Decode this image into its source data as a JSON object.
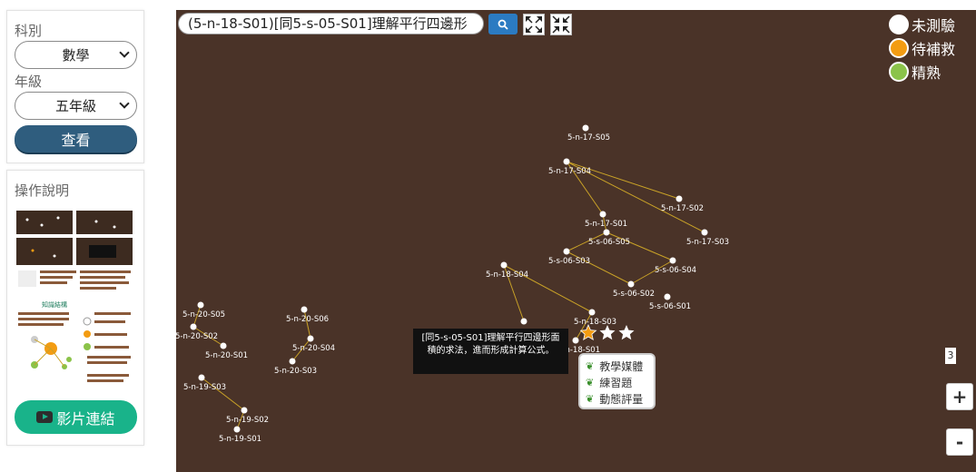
{
  "sidebar": {
    "subject_label": "科別",
    "subject_value": "數學",
    "grade_label": "年級",
    "grade_value": "五年級",
    "view_button": "查看",
    "guide_title": "操作說明",
    "video_button": "影片連結"
  },
  "toolbar": {
    "search_value": "(5-n-18-S01)[同5-s-05-S01]理解平行四邊形",
    "search_icon": "search-icon",
    "expand_icon": "expand-icon",
    "collapse_icon": "collapse-icon"
  },
  "legend": [
    {
      "label": "未測驗",
      "color": "#ffffff"
    },
    {
      "label": "待補救",
      "color": "#f39c12"
    },
    {
      "label": "精熟",
      "color": "#8bc34a"
    }
  ],
  "nodes": [
    {
      "id": "5-n-17-S05"
    },
    {
      "id": "5-n-17-S04"
    },
    {
      "id": "5-n-17-S02"
    },
    {
      "id": "5-n-17-S01"
    },
    {
      "id": "5-n-17-S03"
    },
    {
      "id": "5-s-06-S05"
    },
    {
      "id": "5-s-06-S03"
    },
    {
      "id": "5-s-06-S04"
    },
    {
      "id": "5-s-06-S02"
    },
    {
      "id": "5-s-06-S01"
    },
    {
      "id": "5-n-18-S04"
    },
    {
      "id": "5-n-18-S03"
    },
    {
      "id": "5-n-18-S01"
    },
    {
      "id": "5-n-20-S05"
    },
    {
      "id": "5-n-20-S02"
    },
    {
      "id": "5-n-20-S01"
    },
    {
      "id": "5-n-20-S06"
    },
    {
      "id": "5-n-20-S04"
    },
    {
      "id": "5-n-20-S03"
    },
    {
      "id": "5-n-19-S03"
    },
    {
      "id": "5-n-19-S02"
    },
    {
      "id": "5-n-19-S01"
    }
  ],
  "edges": [
    [
      "5-n-17-S04",
      "5-n-17-S02"
    ],
    [
      "5-n-17-S04",
      "5-n-17-S01"
    ],
    [
      "5-n-17-S04",
      "5-n-17-S03"
    ],
    [
      "5-n-17-S01",
      "5-s-06-S05"
    ],
    [
      "5-s-06-S05",
      "5-s-06-S03"
    ],
    [
      "5-s-06-S05",
      "5-s-06-S04"
    ],
    [
      "5-s-06-S03",
      "5-s-06-S02"
    ],
    [
      "5-s-06-S04",
      "5-s-06-S02"
    ],
    [
      "5-n-18-S04",
      "5-n-18-S03"
    ],
    [
      "5-n-18-S04",
      "5-n-18-S02"
    ],
    [
      "5-n-18-S03",
      "5-n-18-S01"
    ],
    [
      "5-n-20-S05",
      "5-n-20-S02"
    ],
    [
      "5-n-20-S02",
      "5-n-20-S01"
    ],
    [
      "5-n-20-S06",
      "5-n-20-S04"
    ],
    [
      "5-n-20-S04",
      "5-n-20-S03"
    ],
    [
      "5-n-19-S03",
      "5-n-19-S02"
    ],
    [
      "5-n-19-S02",
      "5-n-19-S01"
    ]
  ],
  "tooltip": "[同5-s-05-S01]理解平行四邊形面積的求法，進而形成計算公式。",
  "context_menu": [
    "教學媒體",
    "練習題",
    "動態評量"
  ],
  "zoom": {
    "level": "3",
    "plus": "+",
    "minus": "-"
  }
}
